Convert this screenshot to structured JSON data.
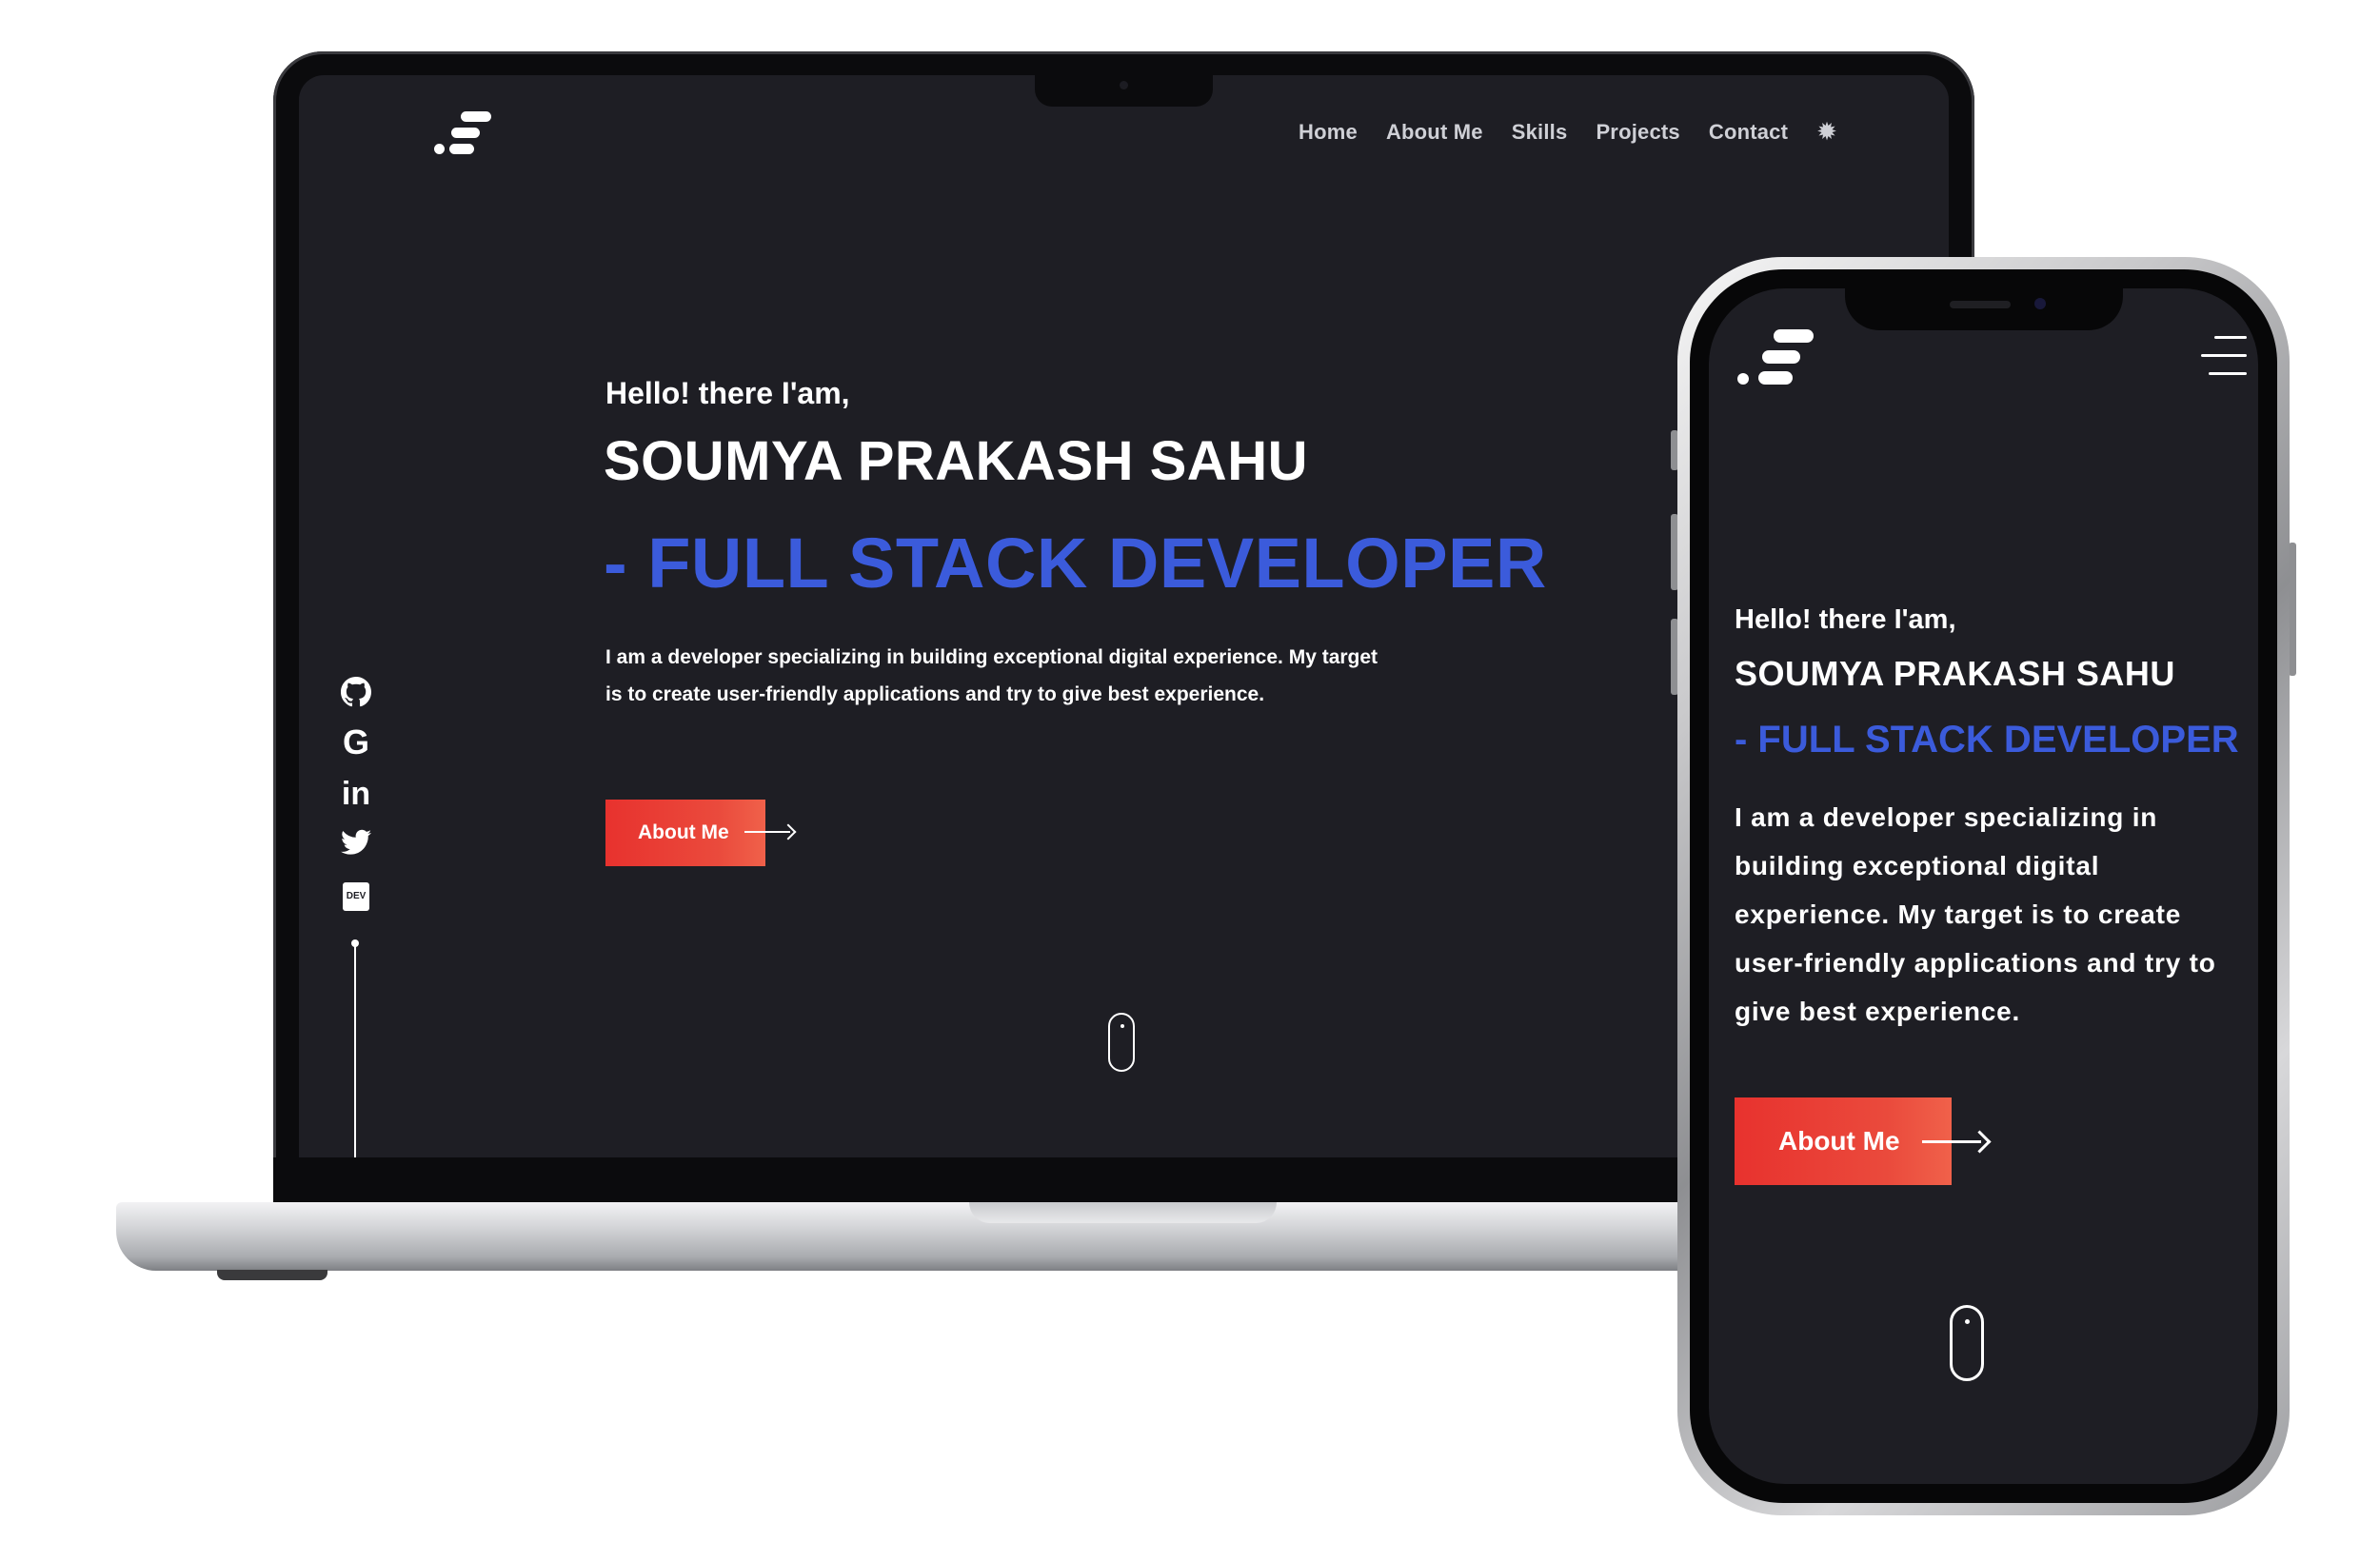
{
  "laptop": {
    "nav": {
      "items": [
        "Home",
        "About Me",
        "Skills",
        "Projects",
        "Contact"
      ],
      "theme_toggle_icon": "gear-icon"
    },
    "hero": {
      "greeting": "Hello! there I'am,",
      "name": "SOUMYA PRAKASH SAHU",
      "role": "- FULL STACK DEVELOPER",
      "description": "I am a developer specializing in building exceptional digital experience. My target is to create user-friendly applications and try to give best experience.",
      "cta_label": "About Me"
    },
    "social_icons": [
      "github-icon",
      "google-icon",
      "linkedin-icon",
      "twitter-icon",
      "dev-icon"
    ],
    "social_glyphs": {
      "google": "G",
      "linkedin": "in",
      "dev": "DEV"
    }
  },
  "phone": {
    "menu_icon": "hamburger-menu-icon",
    "hero": {
      "greeting": "Hello! there I'am,",
      "name": "SOUMYA PRAKASH SAHU",
      "role": "- FULL STACK DEVELOPER",
      "description": "I am a developer specializing in building exceptional digital experience. My target is to create user-friendly applications and try to give best experience.",
      "cta_label": "About Me"
    }
  },
  "colors": {
    "background": "#1e1e24",
    "accent_blue": "#3b5bdb",
    "accent_red": "#e8322e",
    "text": "#ffffff",
    "nav_text": "#cfd0d6"
  }
}
